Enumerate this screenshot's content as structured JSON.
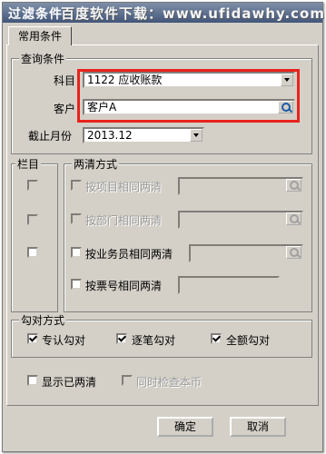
{
  "window": {
    "title": "过滤条件",
    "watermark": "百度软件下载：www.ufidawhy.com"
  },
  "tabs": [
    {
      "label": "常用条件"
    }
  ],
  "query": {
    "legend": "查询条件",
    "subject_label": "科目",
    "subject_value": "1122 应收账款",
    "customer_label": "客户",
    "customer_value": "客户A",
    "cutoff_label": "截止月份",
    "cutoff_value": "2013.12"
  },
  "column": {
    "legend": "栏目"
  },
  "reconcile": {
    "legend": "两清方式",
    "by_project": "按项目相同两清",
    "by_department": "按部门相同两清",
    "by_salesperson": "按业务员相同两清",
    "by_ticket": "按票号相同两清"
  },
  "verify": {
    "legend": "勾对方式",
    "special": "专认勾对",
    "one_by_one": "逐笔勾对",
    "total": "全额勾对"
  },
  "show_cleared": "显示已两清",
  "check_currency": "同时检查本币",
  "buttons": {
    "ok": "确定",
    "cancel": "取消"
  }
}
